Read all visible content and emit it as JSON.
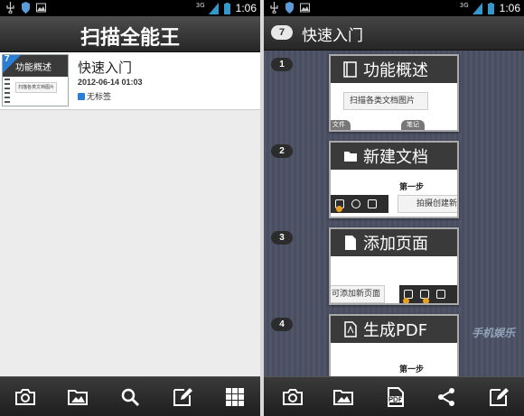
{
  "left": {
    "status": {
      "time": "1:06",
      "network": "3G"
    },
    "title": "扫描全能王",
    "document": {
      "name": "快速入门",
      "date": "2012-06-14 01:03",
      "tag": "无标签",
      "page_count": "7",
      "thumb_title": "功能概述",
      "thumb_box": "扫描各类文档图片"
    },
    "toolbar": [
      "camera-icon",
      "gallery-icon",
      "search-icon",
      "edit-icon",
      "grid-icon"
    ]
  },
  "right": {
    "status": {
      "time": "1:06",
      "network": "3G"
    },
    "header": {
      "count": "7",
      "title": "快速入门"
    },
    "pages": [
      {
        "num": "1",
        "title": "功能概述",
        "box": "扫描各类文档图片",
        "pill_left": "文件",
        "pill_right": "笔记"
      },
      {
        "num": "2",
        "title": "新建文档",
        "step": "第一步",
        "box": "拍摄创建新"
      },
      {
        "num": "3",
        "title": "添加页面",
        "box": "可添加新页面"
      },
      {
        "num": "4",
        "title": "生成PDF",
        "step": "第一步"
      }
    ],
    "toolbar": [
      "camera-icon",
      "gallery-icon",
      "pdf-icon",
      "share-icon",
      "edit-icon"
    ],
    "watermark": "手机娱乐"
  },
  "colors": {
    "accent": "#2a7fd4",
    "header": "#2e2e2e",
    "highlight": "#e8a020"
  }
}
